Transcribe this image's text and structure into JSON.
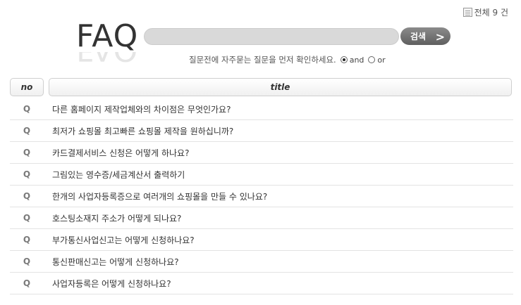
{
  "header": {
    "total_label": "전체 9 건",
    "logo_text": "FAQ"
  },
  "search": {
    "value": "",
    "placeholder": "",
    "button_label": "검색",
    "hint": "질문전에 자주묻는 질문을 먼저 확인하세요.",
    "options": [
      {
        "label": "and",
        "checked": true
      },
      {
        "label": "or",
        "checked": false
      }
    ]
  },
  "table": {
    "headers": {
      "no": "no",
      "title": "title"
    },
    "rows": [
      {
        "marker": "Q",
        "title": "다른 홈페이지 제작업체와의 차이점은 무엇인가요?"
      },
      {
        "marker": "Q",
        "title": "최저가 쇼핑몰 최고빠른 쇼핑몰 제작을 원하십니까?"
      },
      {
        "marker": "Q",
        "title": "카드결제서비스 신청은 어떻게 하나요?"
      },
      {
        "marker": "Q",
        "title": "그림있는 영수증/세금계산서 출력하기"
      },
      {
        "marker": "Q",
        "title": "한개의 사업자등록증으로 여러개의 쇼핑몰을 만들 수 있나요?"
      },
      {
        "marker": "Q",
        "title": "호스팅소재지 주소가 어떻게 되나요?"
      },
      {
        "marker": "Q",
        "title": "부가통신사업신고는 어떻게 신청하나요?"
      },
      {
        "marker": "Q",
        "title": "통신판매신고는 어떻게 신청하나요?"
      },
      {
        "marker": "Q",
        "title": "사업자등록은 어떻게 신청하나요?"
      }
    ]
  }
}
